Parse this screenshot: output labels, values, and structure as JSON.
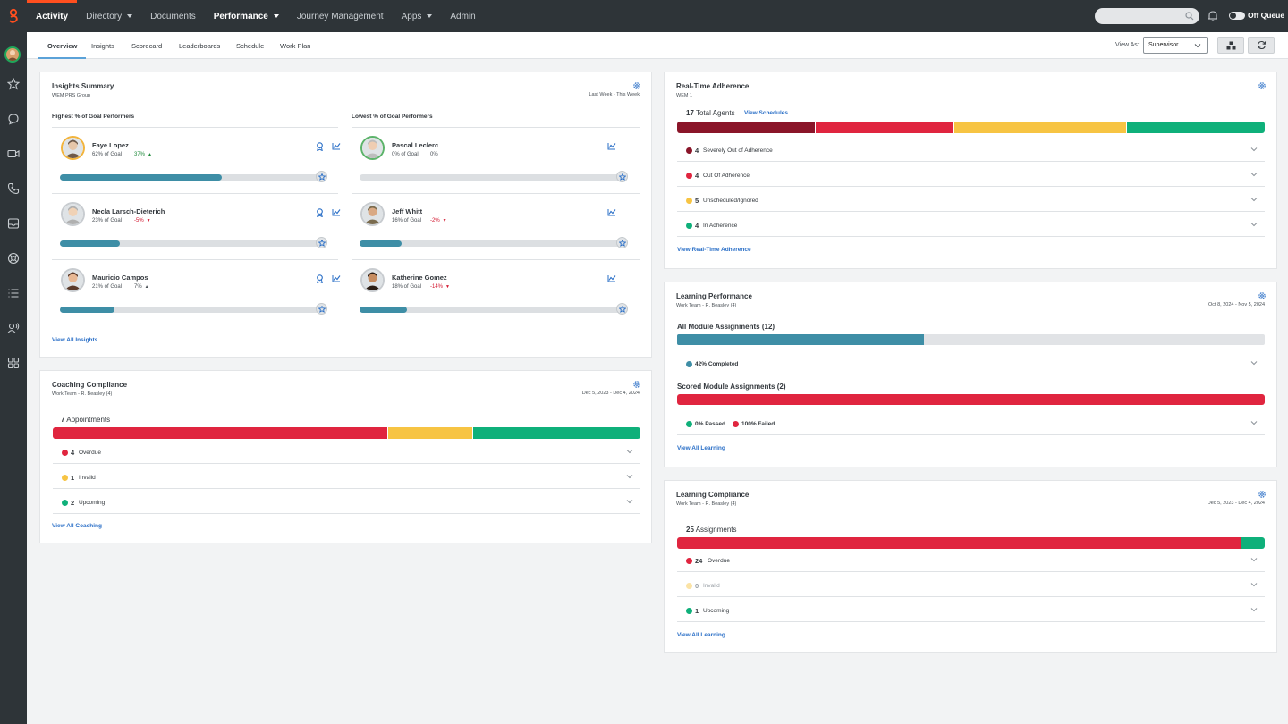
{
  "nav": {
    "items": [
      {
        "label": "Activity"
      },
      {
        "label": "Directory"
      },
      {
        "label": "Documents"
      },
      {
        "label": "Performance"
      },
      {
        "label": "Journey Management"
      },
      {
        "label": "Apps"
      },
      {
        "label": "Admin"
      }
    ],
    "off_queue": "Off Queue"
  },
  "subnav": {
    "tabs": [
      {
        "label": "Overview"
      },
      {
        "label": "Insights"
      },
      {
        "label": "Scorecard"
      },
      {
        "label": "Leaderboards"
      },
      {
        "label": "Schedule"
      },
      {
        "label": "Work Plan"
      }
    ],
    "view_as_label": "View As:",
    "view_as_value": "Supervisor"
  },
  "insights": {
    "title": "Insights Summary",
    "subtitle": "WEM PRS Group",
    "date": "Last Week - This Week",
    "highest_label": "Highest % of Goal Performers",
    "lowest_label": "Lowest % of Goal Performers",
    "highest": [
      {
        "name": "Faye Lopez",
        "goal": "62% of Goal",
        "trend": "37%",
        "fill": 0.62
      },
      {
        "name": "Necla Larsch-Dieterich",
        "goal": "23% of Goal",
        "trend": "-5%",
        "fill": 0.23
      },
      {
        "name": "Mauricio Campos",
        "goal": "21% of Goal",
        "trend": "7%",
        "fill": 0.21
      }
    ],
    "lowest": [
      {
        "name": "Pascal Leclerc",
        "goal": "0% of Goal",
        "trend": "0%",
        "fill": 0
      },
      {
        "name": "Jeff Whitt",
        "goal": "16% of Goal",
        "trend": "-2%",
        "fill": 0.16
      },
      {
        "name": "Katherine Gomez",
        "goal": "18% of Goal",
        "trend": "-14%",
        "fill": 0.18
      }
    ],
    "link": "View All Insights"
  },
  "coaching": {
    "title": "Coaching Compliance",
    "subtitle": "Work Team - R. Beasley (4)",
    "date": "Dec 5, 2023 - Dec 4, 2024",
    "total_count": "7",
    "total_label": "Appointments",
    "rows": [
      {
        "count": "4",
        "label": "Overdue",
        "color": "#e0253f",
        "value": 4
      },
      {
        "count": "1",
        "label": "Invalid",
        "color": "#f7c443",
        "value": 1
      },
      {
        "count": "2",
        "label": "Upcoming",
        "color": "#0fb07a",
        "value": 2
      }
    ],
    "link": "View All Coaching"
  },
  "adherence": {
    "title": "Real-Time Adherence",
    "subtitle": "WEM 1",
    "total_count": "17",
    "total_label": "Total Agents",
    "schedules_link": "View Schedules",
    "rows": [
      {
        "count": "4",
        "label": "Severely Out of Adherence",
        "color": "#8a1529",
        "value": 4
      },
      {
        "count": "4",
        "label": "Out Of Adherence",
        "color": "#e0253f",
        "value": 4
      },
      {
        "count": "5",
        "label": "Unscheduled/Ignored",
        "color": "#f7c443",
        "value": 5
      },
      {
        "count": "4",
        "label": "In Adherence",
        "color": "#0fb07a",
        "value": 4
      }
    ],
    "link": "View Real-Time Adherence"
  },
  "learning_perf": {
    "title": "Learning Performance",
    "subtitle": "Work Team - R. Beasley (4)",
    "date": "Oct 8, 2024 - Nov 5, 2024",
    "all_label": "All Module Assignments (12)",
    "all_fill": 0.42,
    "completed": "42% Completed",
    "scored_label": "Scored Module Assignments (2)",
    "passed": "0% Passed",
    "failed": "100% Failed",
    "link": "View All Learning"
  },
  "learning_comp": {
    "title": "Learning Compliance",
    "subtitle": "Work Team - R. Beasley (4)",
    "date": "Dec 5, 2023 - Dec 4, 2024",
    "total_count": "25",
    "total_label": "Assignments",
    "rows": [
      {
        "count": "24",
        "label": "Overdue",
        "color": "#e0253f",
        "value": 24
      },
      {
        "count": "0",
        "label": "Invalid",
        "color": "#fbe3a6",
        "value": 0
      },
      {
        "count": "1",
        "label": "Upcoming",
        "color": "#0fb07a",
        "value": 1
      }
    ],
    "link": "View All Learning"
  }
}
